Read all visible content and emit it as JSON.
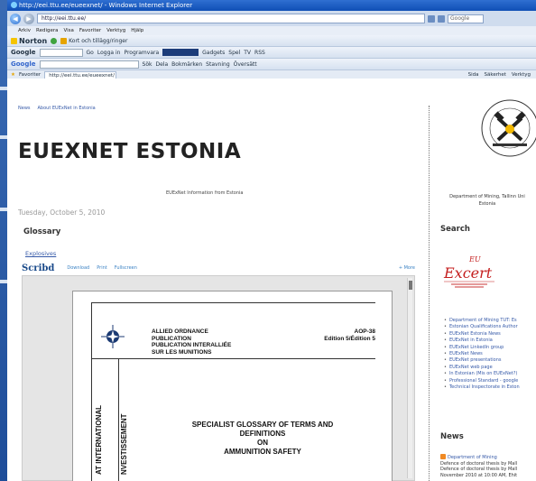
{
  "browser": {
    "title": "http://eei.ttu.ee/eueexnet/ - Windows Internet Explorer",
    "address": "http://eei.ttu.ee/",
    "menu": [
      "Arkiv",
      "Redigera",
      "Visa",
      "Favoriter",
      "Verktyg",
      "Hjälp"
    ],
    "toolbar_norton": "Norton",
    "toolbar_norton_extra": "Kort och tillägg/ringer",
    "toolbar_google": "Google",
    "toolbar_google_items": [
      "Go",
      "Logga in",
      "Programvara",
      "Gadgets",
      "Spel",
      "TV",
      "RSS"
    ],
    "toolbar2_items": [
      "Sök",
      "Dela",
      "Bokmärken",
      "Stavning",
      "Översätt"
    ],
    "tab_label": "http://eei.ttu.ee/eueexnet/",
    "fav_label": "Favoriter",
    "fav_right": [
      "Sida",
      "Säkerhet",
      "Verktyg"
    ],
    "search_placeholder": "Google"
  },
  "blog": {
    "top_links": [
      "News",
      "About EUExNet in Estonia"
    ],
    "title": "EUEXNET ESTONIA",
    "description": "EUExNet Information from Estonia",
    "post_date": "Tuesday, October 5, 2010",
    "post_title": "Glossary",
    "post_link": "Explosives"
  },
  "scribd": {
    "brand": "Scribd",
    "actions": [
      "Download",
      "Print",
      "Fullscreen"
    ],
    "more": "+ More"
  },
  "document": {
    "header_lines": [
      "ALLIED ORDNANCE",
      "PUBLICATION",
      "PUBLICATION INTERALLIÉE",
      "SUR LES MUNITIONS"
    ],
    "aop_lines": [
      "AOP-38",
      "Edition 5/Édition 5"
    ],
    "vertical_1": "AT INTERNATIONAL",
    "vertical_2": "NVESTISSEMENT",
    "title_lines": [
      "SPECIALIST GLOSSARY OF TERMS AND",
      "DEFINITIONS",
      "ON",
      "AMMUNITION SAFETY"
    ]
  },
  "sidebar": {
    "dept": [
      "Department of Mining, Tallinn Uni",
      "Estonia"
    ],
    "search_heading": "Search",
    "logo_text": "EUExcert",
    "links": [
      "Department of Mining TUT: Es",
      "Estonian Qualifications Author",
      "EUExNet Estonia News",
      "EUExNet in Estonia",
      "EUExNet LinkedIn group",
      "EUExNet News",
      "EUExNet presentations",
      "EUExNet web page",
      "In Estonian (Mis on EUExNet?)",
      "Professional Standard - google",
      "Technical Inspectorate in Eston"
    ],
    "news_heading": "News",
    "news_source": "Department of Mining",
    "news_lines": [
      "Defence of doctoral thesis by Mall",
      "Defence of doctoral thesis by Mall",
      "November 2010 at 10:00 AM, Ehit"
    ]
  }
}
